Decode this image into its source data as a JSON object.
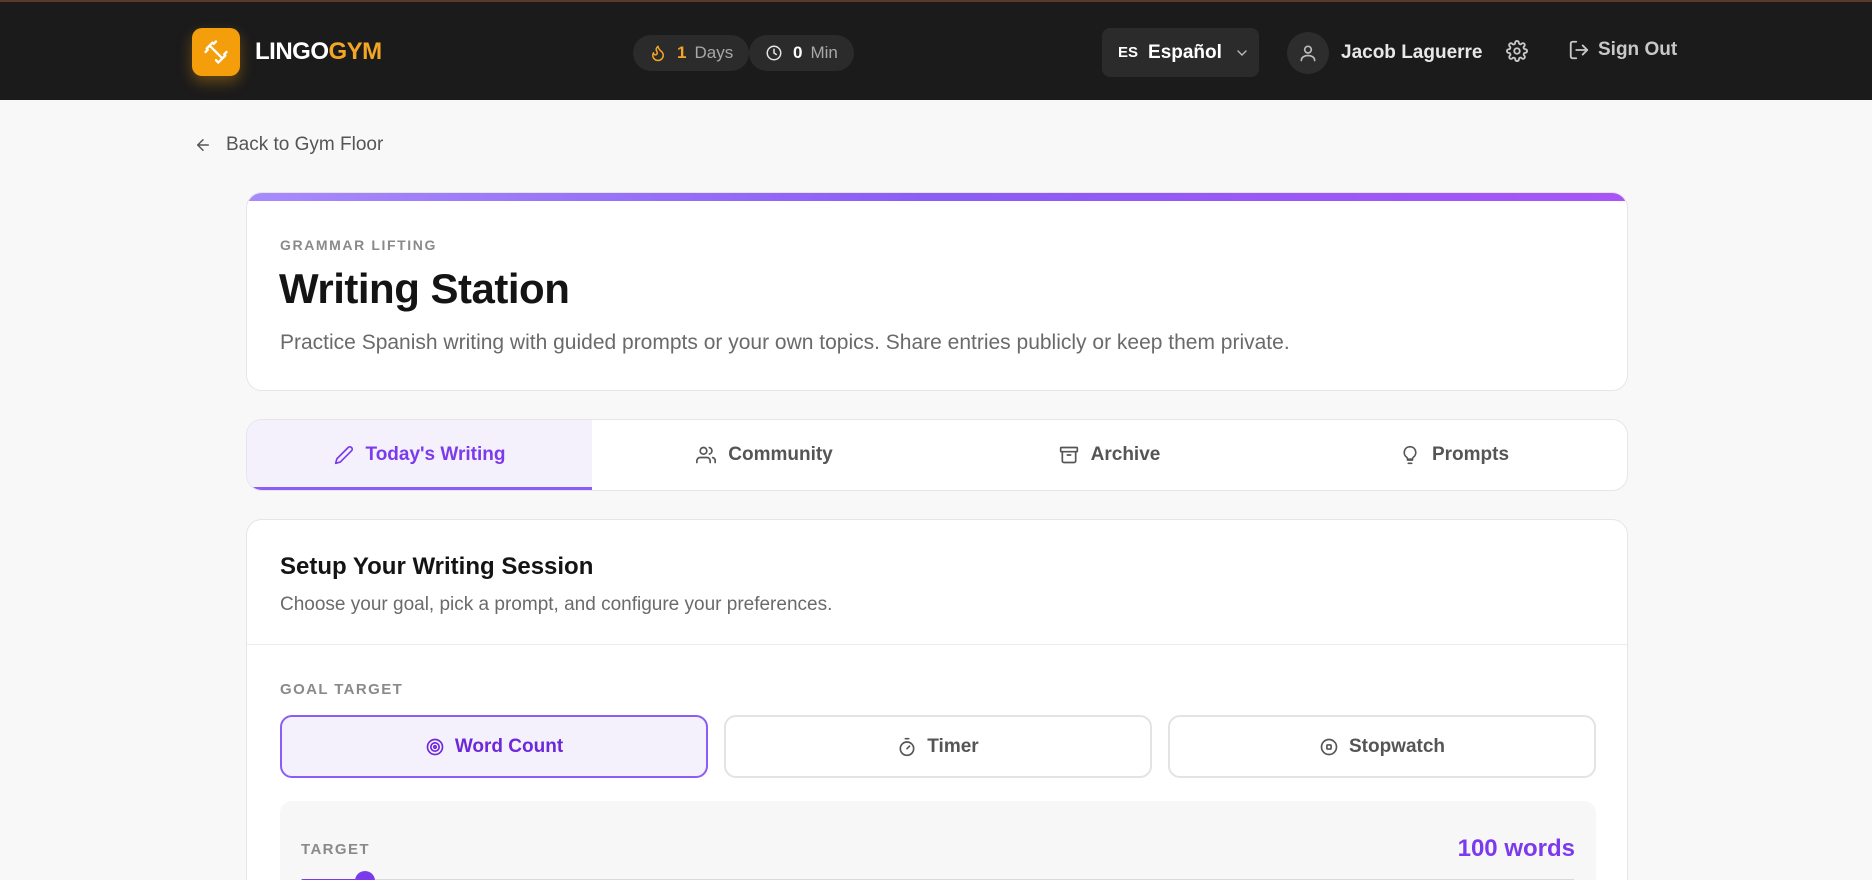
{
  "header": {
    "logo_primary": "LINGO",
    "logo_accent": "GYM",
    "logo_icon": "dumbbell-icon",
    "streak": {
      "icon": "flame-icon",
      "value": "1",
      "unit": "Days"
    },
    "minutes": {
      "icon": "clock-icon",
      "value": "0",
      "unit": "Min"
    },
    "language": {
      "code": "ES",
      "name": "Español"
    },
    "user": {
      "name": "Jacob Laguerre",
      "icon": "user-icon"
    },
    "settings_icon": "gear-icon",
    "sign_out_label": "Sign Out"
  },
  "back_link": {
    "label": "Back to Gym Floor"
  },
  "page": {
    "eyebrow": "GRAMMAR LIFTING",
    "title": "Writing Station",
    "description": "Practice Spanish writing with guided prompts or your own topics. Share entries publicly or keep them private.",
    "accent_color": "#8b5cf6"
  },
  "tabs": [
    {
      "label": "Today's Writing",
      "icon": "pencil-icon",
      "active": true
    },
    {
      "label": "Community",
      "icon": "users-icon",
      "active": false
    },
    {
      "label": "Archive",
      "icon": "archive-icon",
      "active": false
    },
    {
      "label": "Prompts",
      "icon": "lightbulb-icon",
      "active": false
    }
  ],
  "setup": {
    "title": "Setup Your Writing Session",
    "description": "Choose your goal, pick a prompt, and configure your preferences.",
    "goal_label": "GOAL TARGET",
    "goals": [
      {
        "label": "Word Count",
        "icon": "target-icon",
        "active": true
      },
      {
        "label": "Timer",
        "icon": "timer-icon",
        "active": false
      },
      {
        "label": "Stopwatch",
        "icon": "stopwatch-icon",
        "active": false
      }
    ],
    "target": {
      "label": "TARGET",
      "value_text": "100 words",
      "slider_fraction": 0.05
    }
  }
}
